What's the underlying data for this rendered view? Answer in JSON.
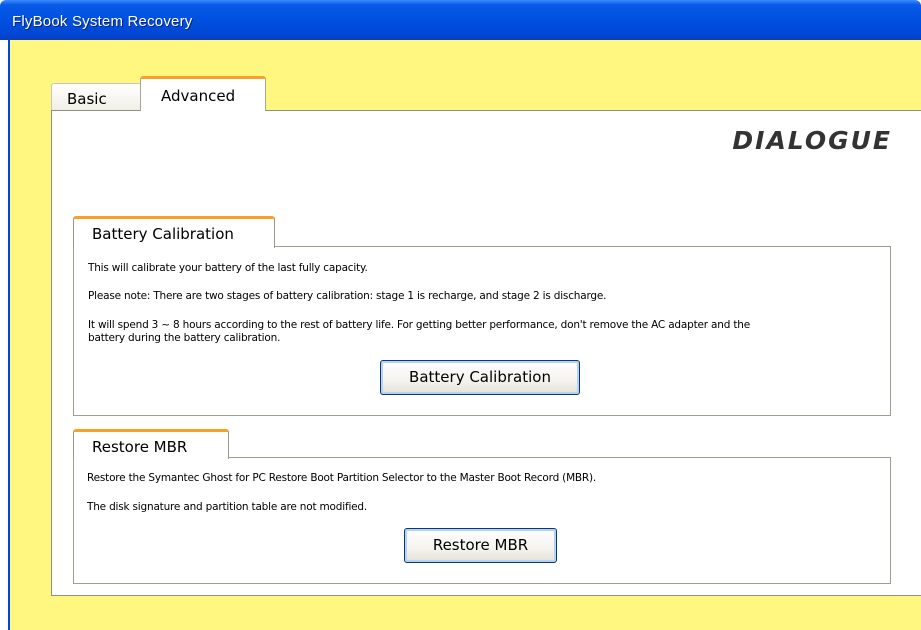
{
  "window": {
    "title": "FlyBook System Recovery"
  },
  "tabs": [
    {
      "label": "Basic",
      "selected": false
    },
    {
      "label": "Advanced",
      "selected": true
    }
  ],
  "logo": {
    "text": "DIALOGUE"
  },
  "battery": {
    "group_label": "Battery Calibration",
    "line1": "This will calibrate your battery of the last fully capacity.",
    "line2": "Please note: There are two stages of battery calibration: stage 1 is recharge, and stage 2 is discharge.",
    "line3a": "It will spend 3 ~ 8 hours according to the rest of battery life. For getting better performance, don't remove the AC adapter and the",
    "line3b": "battery during the battery calibration.",
    "button_label": "Battery Calibration"
  },
  "mbr": {
    "group_label": "Restore MBR",
    "line1": "Restore the Symantec Ghost for PC Restore Boot Partition Selector to the Master Boot Record (MBR).",
    "line2": "The disk signature and partition table are not modified.",
    "button_label": "Restore MBR"
  },
  "colors": {
    "titlebar": "#0050e0",
    "client_background": "#fff780",
    "tab_accent": "#f8a12a",
    "button_border": "#003c74"
  }
}
